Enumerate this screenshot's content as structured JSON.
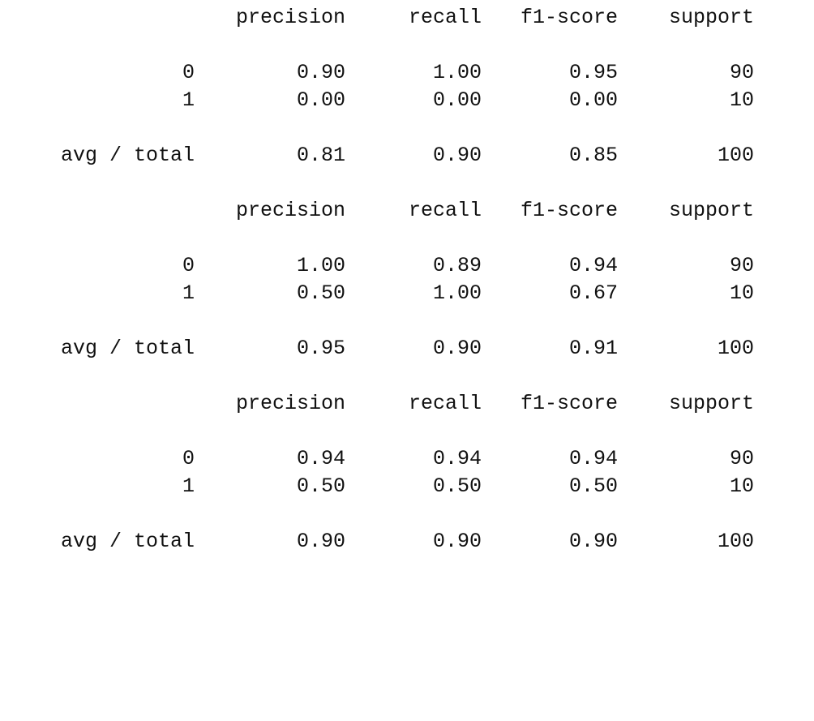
{
  "headers": {
    "precision": "precision",
    "recall": "recall",
    "f1_score": "f1-score",
    "support": "support"
  },
  "reports": [
    {
      "rows": [
        {
          "label": "0",
          "precision": "0.90",
          "recall": "1.00",
          "f1_score": "0.95",
          "support": "90"
        },
        {
          "label": "1",
          "precision": "0.00",
          "recall": "0.00",
          "f1_score": "0.00",
          "support": "10"
        }
      ],
      "total": {
        "label": "avg / total",
        "precision": "0.81",
        "recall": "0.90",
        "f1_score": "0.85",
        "support": "100"
      }
    },
    {
      "rows": [
        {
          "label": "0",
          "precision": "1.00",
          "recall": "0.89",
          "f1_score": "0.94",
          "support": "90"
        },
        {
          "label": "1",
          "precision": "0.50",
          "recall": "1.00",
          "f1_score": "0.67",
          "support": "10"
        }
      ],
      "total": {
        "label": "avg / total",
        "precision": "0.95",
        "recall": "0.90",
        "f1_score": "0.91",
        "support": "100"
      }
    },
    {
      "rows": [
        {
          "label": "0",
          "precision": "0.94",
          "recall": "0.94",
          "f1_score": "0.94",
          "support": "90"
        },
        {
          "label": "1",
          "precision": "0.50",
          "recall": "0.50",
          "f1_score": "0.50",
          "support": "10"
        }
      ],
      "total": {
        "label": "avg / total",
        "precision": "0.90",
        "recall": "0.90",
        "f1_score": "0.90",
        "support": "100"
      }
    }
  ]
}
